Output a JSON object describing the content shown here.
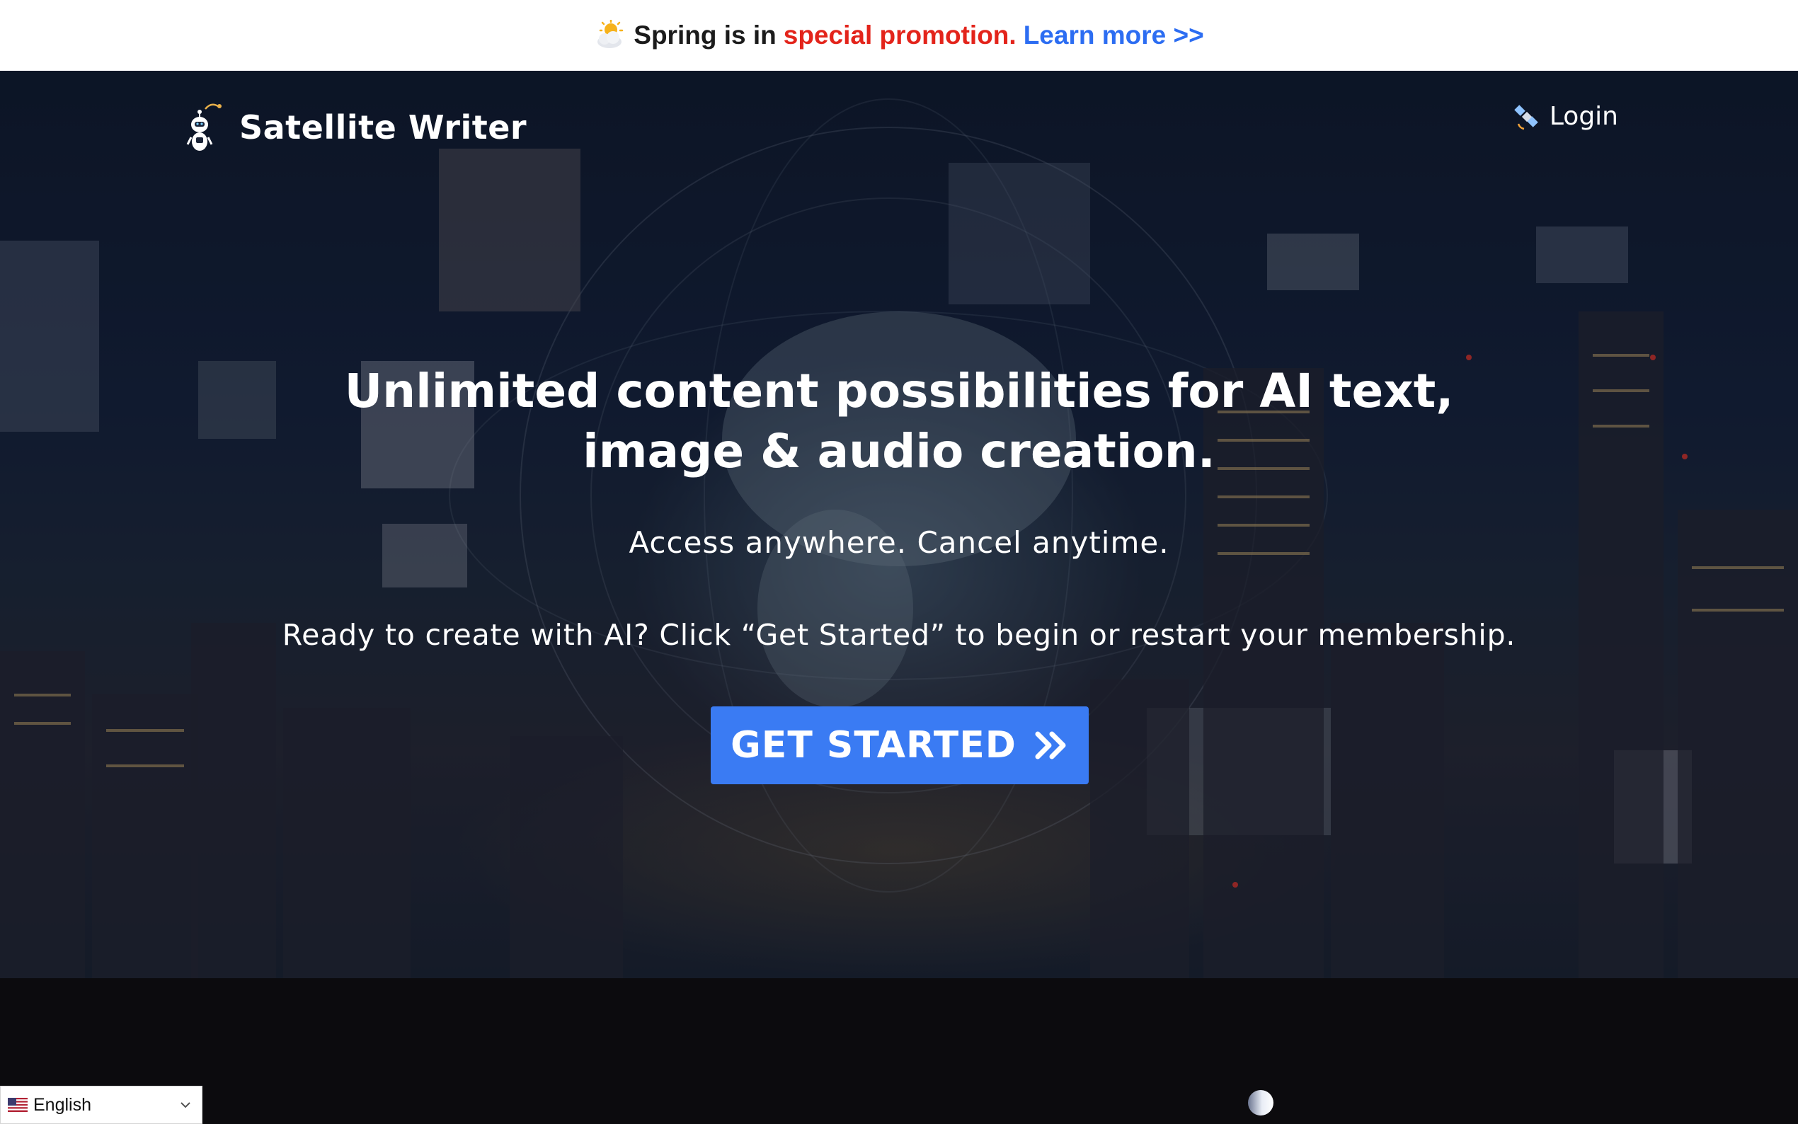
{
  "promo": {
    "lead": "Spring is in",
    "highlight": "special promotion.",
    "link_label": "Learn more >>",
    "highlight_color": "#e3241b",
    "link_color": "#2c6df2",
    "icon": "sun-behind-cloud-icon"
  },
  "header": {
    "brand_name": "Satellite Writer",
    "brand_icon": "robot-icon",
    "login_label": "Login",
    "login_icon": "satellite-icon"
  },
  "hero": {
    "headline_line1": "Unlimited content possibilities for AI text,",
    "headline_line2": "image & audio creation.",
    "subheadline": "Access anywhere. Cancel anytime.",
    "cta_text": "Ready to create with AI? Click “Get Started” to begin or restart your membership.",
    "button_label": "GET STARTED",
    "button_icon": "double-chevron-right-icon",
    "button_color": "#3a7bf3"
  },
  "language_selector": {
    "selected": "English",
    "flag_icon": "us-flag-icon",
    "chevron_icon": "chevron-down-icon"
  },
  "loader": {
    "icon": "loading-spinner-icon"
  }
}
